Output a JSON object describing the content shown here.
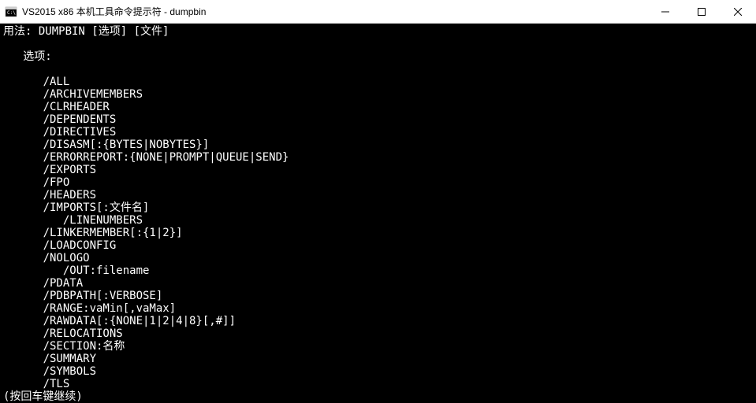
{
  "window": {
    "title": "VS2015 x86 本机工具命令提示符 - dumpbin"
  },
  "console": {
    "lines": [
      "用法: DUMPBIN [选项] [文件]",
      "",
      "   选项:",
      "",
      "      /ALL",
      "      /ARCHIVEMEMBERS",
      "      /CLRHEADER",
      "      /DEPENDENTS",
      "      /DIRECTIVES",
      "      /DISASM[:{BYTES|NOBYTES}]",
      "      /ERRORREPORT:{NONE|PROMPT|QUEUE|SEND}",
      "      /EXPORTS",
      "      /FPO",
      "      /HEADERS",
      "      /IMPORTS[:文件名]",
      "         /LINENUMBERS",
      "      /LINKERMEMBER[:{1|2}]",
      "      /LOADCONFIG",
      "      /NOLOGO",
      "         /OUT:filename",
      "      /PDATA",
      "      /PDBPATH[:VERBOSE]",
      "      /RANGE:vaMin[,vaMax]",
      "      /RAWDATA[:{NONE|1|2|4|8}[,#]]",
      "      /RELOCATIONS",
      "      /SECTION:名称",
      "      /SUMMARY",
      "      /SYMBOLS",
      "      /TLS",
      "(按回车键继续)"
    ]
  }
}
